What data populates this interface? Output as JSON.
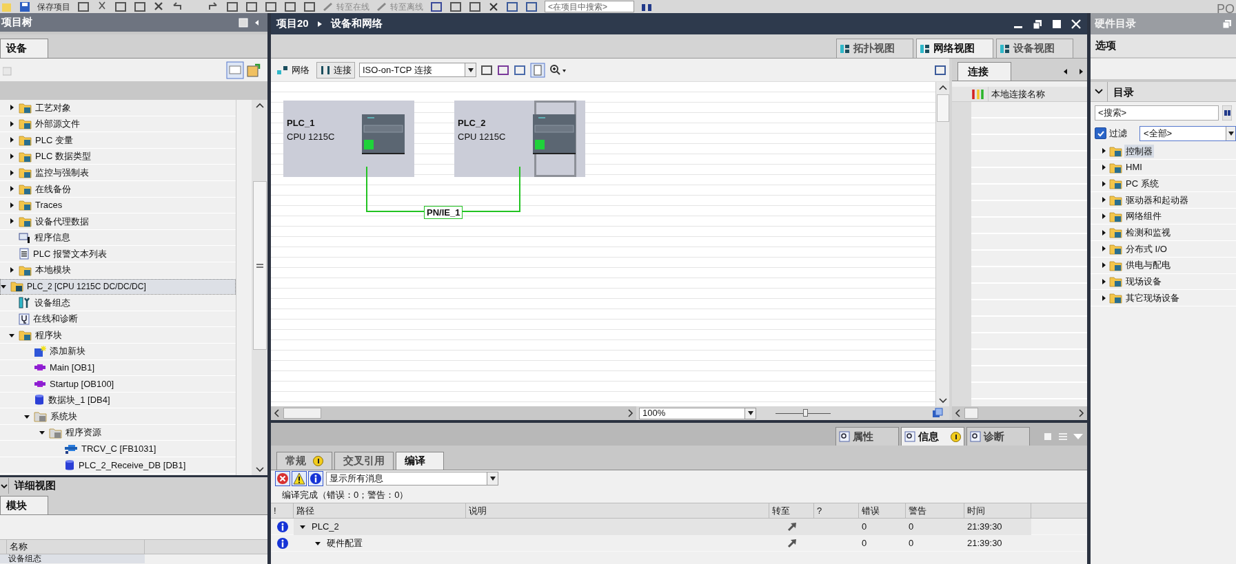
{
  "toolbar": {
    "save_label": "保存项目",
    "go_online": "转至在线",
    "go_offline": "转至离线",
    "search_placeholder": "<在项目中搜索>",
    "corner_text": "PO"
  },
  "project_tree": {
    "title": "项目树",
    "tabs": [
      {
        "label": "设备",
        "selected": true
      }
    ],
    "items": [
      {
        "children": [
          {
            "label": "工艺对象",
            "kind": "folder",
            "expanded": false,
            "selected": false
          },
          {
            "label": "外部源文件",
            "kind": "folder",
            "expanded": false,
            "selected": false
          },
          {
            "label": "PLC 变量",
            "kind": "folder",
            "expanded": false,
            "selected": false
          },
          {
            "label": "PLC 数据类型",
            "kind": "folder",
            "expanded": false,
            "selected": false
          },
          {
            "label": "监控与强制表",
            "kind": "folder",
            "expanded": false,
            "selected": false
          },
          {
            "label": "在线备份",
            "kind": "folder",
            "expanded": false,
            "selected": false
          },
          {
            "label": "Traces",
            "kind": "folder",
            "expanded": false,
            "selected": false
          },
          {
            "label": "设备代理数据",
            "kind": "folder",
            "expanded": false,
            "selected": false
          },
          {
            "label": "程序信息",
            "kind": "info",
            "selected": false
          },
          {
            "label": "PLC 报警文本列表",
            "kind": "text-list",
            "selected": false
          },
          {
            "label": "本地模块",
            "kind": "folder",
            "expanded": false,
            "selected": false
          }
        ]
      },
      {
        "label": "PLC_2 [CPU 1215C DC/DC/DC]",
        "kind": "device",
        "expanded": true,
        "selected": true,
        "children": [
          {
            "label": "设备组态",
            "kind": "config",
            "selected": false
          },
          {
            "label": "在线和诊断",
            "kind": "diagnostics",
            "selected": false
          },
          {
            "label": "程序块",
            "kind": "folder",
            "expanded": true,
            "selected": false,
            "children": [
              {
                "label": "添加新块",
                "kind": "add-block",
                "selected": false
              },
              {
                "label": "Main [OB1]",
                "kind": "org-block",
                "selected": false
              },
              {
                "label": "Startup [OB100]",
                "kind": "org-block",
                "selected": false
              },
              {
                "label": "数据块_1 [DB4]",
                "kind": "data-block",
                "selected": false
              },
              {
                "label": "系统块",
                "kind": "system-folder",
                "expanded": true,
                "selected": false,
                "children": [
                  {
                    "label": "程序资源",
                    "kind": "system-folder",
                    "expanded": true,
                    "selected": false,
                    "children": [
                      {
                        "label": "TRCV_C [FB1031]",
                        "kind": "function-block",
                        "selected": false
                      },
                      {
                        "label": "PLC_2_Receive_DB [DB1]",
                        "kind": "data-block",
                        "selected": false
                      }
                    ]
                  }
                ]
              }
            ]
          }
        ]
      }
    ]
  },
  "details_view": {
    "title": "详细视图",
    "expanded": true,
    "tabs": [
      {
        "label": "模块",
        "selected": true
      }
    ],
    "columns": [
      "名称"
    ],
    "rows": [
      "设备组态"
    ]
  },
  "editor": {
    "breadcrumb": [
      "项目20",
      "设备和网络"
    ],
    "view_tabs": [
      {
        "label": "拓扑视图",
        "selected": false
      },
      {
        "label": "网络视图",
        "selected": true
      },
      {
        "label": "设备视图",
        "selected": false
      }
    ],
    "toolbar": {
      "network_label": "网络",
      "connect_label": "连接",
      "connection_type": "ISO-on-TCP 连接"
    },
    "devices": [
      {
        "name": "PLC_1",
        "type": "CPU 1215C",
        "selected": false
      },
      {
        "name": "PLC_2",
        "type": "CPU 1215C",
        "selected": true
      }
    ],
    "subnet": "PN/IE_1",
    "zoom": "100%",
    "zoom_slider": {
      "level": 0.55
    },
    "connections_panel": {
      "tabs": [
        {
          "label": "连接",
          "selected": true
        }
      ],
      "columns": [
        "本地连接名称"
      ]
    }
  },
  "inspector": {
    "tabs": [
      {
        "label": "属性",
        "selected": false,
        "badge": false
      },
      {
        "label": "信息",
        "selected": true,
        "badge": true
      },
      {
        "label": "诊断",
        "selected": false,
        "badge": false
      }
    ],
    "subtabs": [
      {
        "label": "常规",
        "selected": false,
        "badge": true
      },
      {
        "label": "交叉引用",
        "selected": false,
        "badge": false
      },
      {
        "label": "编译",
        "selected": true,
        "badge": false
      }
    ],
    "filters": [
      {
        "kind": "error",
        "on": true
      },
      {
        "kind": "warning",
        "on": true
      },
      {
        "kind": "info",
        "on": true
      }
    ],
    "message_filter": "显示所有消息",
    "status": "编译完成（错误：0；警告：0）",
    "columns": [
      "!",
      "路径",
      "说明",
      "转至",
      "?",
      "错误",
      "警告",
      "时间"
    ],
    "rows": [
      {
        "path": "PLC_2",
        "expanded": true,
        "errors": "0",
        "warnings": "0",
        "time": "21:39:30",
        "children": [
          {
            "path": "硬件配置",
            "expanded": true,
            "errors": "0",
            "warnings": "0",
            "time": "21:39:30"
          }
        ]
      }
    ]
  },
  "catalog": {
    "title": "硬件目录",
    "options_label": "选项",
    "section": {
      "title": "目录",
      "expanded": true
    },
    "search_placeholder": "<搜索>",
    "filter": {
      "label": "过滤",
      "checked": true,
      "value": "<全部>"
    },
    "items": [
      {
        "label": "控制器",
        "expanded": false,
        "selected": true
      },
      {
        "label": "HMI",
        "expanded": false,
        "selected": false
      },
      {
        "label": "PC 系统",
        "expanded": false,
        "selected": false
      },
      {
        "label": "驱动器和起动器",
        "expanded": false,
        "selected": false
      },
      {
        "label": "网络组件",
        "expanded": false,
        "selected": false
      },
      {
        "label": "检测和监视",
        "expanded": false,
        "selected": false
      },
      {
        "label": "分布式 I/O",
        "expanded": false,
        "selected": false
      },
      {
        "label": "供电与配电",
        "expanded": false,
        "selected": false
      },
      {
        "label": "现场设备",
        "expanded": false,
        "selected": false
      },
      {
        "label": "其它现场设备",
        "expanded": false,
        "selected": false
      }
    ]
  }
}
